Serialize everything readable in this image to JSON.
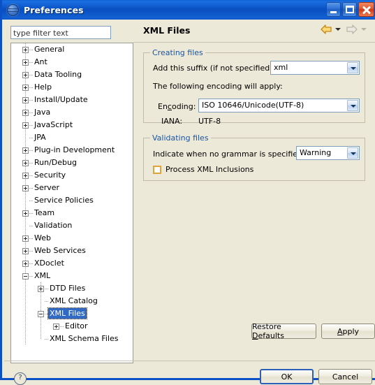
{
  "window": {
    "title": "Preferences",
    "icon": "eclipse-globe-icon",
    "accent_blue": "#0a51c8",
    "face": "#ece9d8",
    "selection_blue": "#316ac5",
    "group_label_blue": "#1b55a6",
    "buttons": {
      "minimize": "minimize",
      "maximize": "maximize",
      "close": "close"
    }
  },
  "filter": {
    "value": "type filter text",
    "placeholder": "type filter text"
  },
  "tree": {
    "items": [
      {
        "label": "General",
        "depth": 0,
        "toggle": "plus"
      },
      {
        "label": "Ant",
        "depth": 0,
        "toggle": "plus"
      },
      {
        "label": "Data Tooling",
        "depth": 0,
        "toggle": "plus"
      },
      {
        "label": "Help",
        "depth": 0,
        "toggle": "plus"
      },
      {
        "label": "Install/Update",
        "depth": 0,
        "toggle": "plus"
      },
      {
        "label": "Java",
        "depth": 0,
        "toggle": "plus"
      },
      {
        "label": "JavaScript",
        "depth": 0,
        "toggle": "plus"
      },
      {
        "label": "JPA",
        "depth": 0,
        "toggle": "none"
      },
      {
        "label": "Plug-in Development",
        "depth": 0,
        "toggle": "plus"
      },
      {
        "label": "Run/Debug",
        "depth": 0,
        "toggle": "plus"
      },
      {
        "label": "Security",
        "depth": 0,
        "toggle": "plus"
      },
      {
        "label": "Server",
        "depth": 0,
        "toggle": "plus"
      },
      {
        "label": "Service Policies",
        "depth": 0,
        "toggle": "none"
      },
      {
        "label": "Team",
        "depth": 0,
        "toggle": "plus"
      },
      {
        "label": "Validation",
        "depth": 0,
        "toggle": "none"
      },
      {
        "label": "Web",
        "depth": 0,
        "toggle": "plus"
      },
      {
        "label": "Web Services",
        "depth": 0,
        "toggle": "plus"
      },
      {
        "label": "XDoclet",
        "depth": 0,
        "toggle": "plus"
      },
      {
        "label": "XML",
        "depth": 0,
        "toggle": "minus"
      },
      {
        "label": "DTD Files",
        "depth": 1,
        "toggle": "plus"
      },
      {
        "label": "XML Catalog",
        "depth": 1,
        "toggle": "none"
      },
      {
        "label": "XML Files",
        "depth": 1,
        "toggle": "minus",
        "selected": true
      },
      {
        "label": "Editor",
        "depth": 2,
        "toggle": "plus"
      },
      {
        "label": "XML Schema Files",
        "depth": 1,
        "toggle": "none"
      }
    ]
  },
  "header": {
    "title": "XML Files",
    "back_icon": "back-arrow-icon",
    "forward_icon": "forward-arrow-icon",
    "back_enabled": true,
    "forward_enabled": false
  },
  "creating_files": {
    "legend": "Creating files",
    "suffix_label": "Add this suffix (if not specified):",
    "suffix_value": "xml",
    "encoding_note": "The following encoding will apply:",
    "encoding_label_pre": "En",
    "encoding_label_mnem": "c",
    "encoding_label_post": "oding:",
    "encoding_value": "ISO 10646/Unicode(UTF-8)",
    "iana_label": "IANA:",
    "iana_value": "UTF-8"
  },
  "validating_files": {
    "legend": "Validating files",
    "grammar_label": "Indicate when no grammar is specified:",
    "grammar_value": "Warning",
    "inclusions_label": "Process XML Inclusions",
    "inclusions_checked": false
  },
  "footer": {
    "restore_pre": "Restore ",
    "restore_mnem": "D",
    "restore_post": "efaults",
    "apply_pre": "",
    "apply_mnem": "A",
    "apply_post": "pply",
    "ok": "OK",
    "cancel": "Cancel",
    "help_icon": "question-mark-icon",
    "help_glyph": "?"
  }
}
